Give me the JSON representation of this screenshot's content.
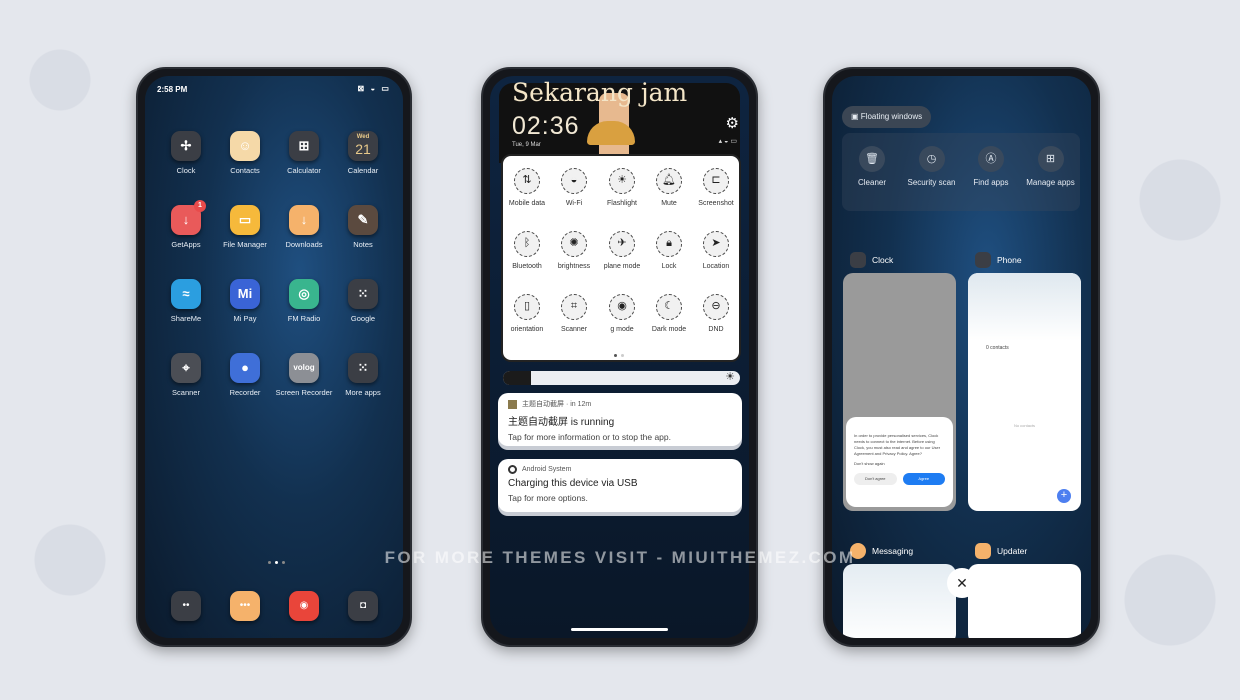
{
  "home": {
    "time": "2:58 PM",
    "apps": [
      {
        "label": "Clock",
        "icon": "clock-icon",
        "color": "#3b3e45",
        "glyph": "✢"
      },
      {
        "label": "Contacts",
        "icon": "contacts-icon",
        "color": "#f5d9a8",
        "glyph": "☺"
      },
      {
        "label": "Calculator",
        "icon": "calculator-icon",
        "color": "#3b3e45",
        "glyph": "⊞"
      },
      {
        "label": "Calendar",
        "icon": "calendar-icon",
        "color": "#3b3e45",
        "glyph": "21",
        "sub": "Wed"
      },
      {
        "label": "GetApps",
        "icon": "getapps-icon",
        "color": "#e95a5a",
        "glyph": "↓",
        "badge": "1"
      },
      {
        "label": "File Manager",
        "icon": "file-manager-icon",
        "color": "#f6b93b",
        "glyph": "▭"
      },
      {
        "label": "Downloads",
        "icon": "downloads-icon",
        "color": "#f5b26b",
        "glyph": "↓"
      },
      {
        "label": "Notes",
        "icon": "notes-icon",
        "color": "#5b4a3f",
        "glyph": "✎"
      },
      {
        "label": "ShareMe",
        "icon": "shareme-icon",
        "color": "#2b9ee0",
        "glyph": "≈"
      },
      {
        "label": "Mi Pay",
        "icon": "mi-pay-icon",
        "color": "#3a64d6",
        "glyph": "Mi"
      },
      {
        "label": "FM Radio",
        "icon": "fm-radio-icon",
        "color": "#39b58e",
        "glyph": "◎"
      },
      {
        "label": "Google",
        "icon": "google-folder-icon",
        "color": "#3b3e45",
        "glyph": "⁙"
      },
      {
        "label": "Scanner",
        "icon": "scanner-icon",
        "color": "#4b4e55",
        "glyph": "⌖"
      },
      {
        "label": "Recorder",
        "icon": "recorder-icon",
        "color": "#3f6fd8",
        "glyph": "●"
      },
      {
        "label": "Screen Recorder",
        "icon": "screen-recorder-icon",
        "color": "#8c8f95",
        "glyph": "volog"
      },
      {
        "label": "More apps",
        "icon": "more-apps-folder-icon",
        "color": "#3b3e45",
        "glyph": "⁙"
      }
    ],
    "dock": [
      {
        "icon": "phone-icon",
        "color": "#3b3e45",
        "glyph": "••"
      },
      {
        "icon": "messaging-icon",
        "color": "#f5b26b",
        "glyph": "•••"
      },
      {
        "icon": "chrome-icon",
        "color": "#e9453a",
        "glyph": "◉"
      },
      {
        "icon": "camera-icon",
        "color": "#3b3e45",
        "glyph": "◘"
      }
    ]
  },
  "control": {
    "greeting": "Sekarang jam",
    "time": "02:36",
    "date": "Tue, 9 Mar",
    "tiles": [
      {
        "label": "Mobile data",
        "glyph": "⇅",
        "icon": "mobile-data-icon"
      },
      {
        "label": "Wi-Fi",
        "glyph": "◒",
        "icon": "wifi-icon"
      },
      {
        "label": "Flashlight",
        "glyph": "☀",
        "icon": "flashlight-icon"
      },
      {
        "label": "Mute",
        "glyph": "🔔︎",
        "icon": "bell-icon"
      },
      {
        "label": "Screenshot",
        "glyph": "⊏",
        "icon": "screenshot-icon"
      },
      {
        "label": "Bluetooth",
        "glyph": "ᛒ",
        "icon": "bluetooth-icon"
      },
      {
        "label": "brightness",
        "glyph": "✺",
        "icon": "brightness-icon"
      },
      {
        "label": "plane mode",
        "glyph": "✈",
        "icon": "airplane-icon"
      },
      {
        "label": "Lock",
        "glyph": "🔒︎",
        "icon": "lock-icon"
      },
      {
        "label": "Location",
        "glyph": "➤",
        "icon": "location-icon"
      },
      {
        "label": "orientation",
        "glyph": "▯",
        "icon": "orientation-icon"
      },
      {
        "label": "Scanner",
        "glyph": "⌗",
        "icon": "scanner-icon"
      },
      {
        "label": "g mode",
        "glyph": "◉",
        "icon": "eye-icon"
      },
      {
        "label": "Dark mode",
        "glyph": "☾",
        "icon": "moon-icon"
      },
      {
        "label": "DND",
        "glyph": "⊖",
        "icon": "dnd-icon"
      }
    ],
    "brightness": 0.12,
    "notifications": [
      {
        "app": "主题自动截屏 · in 12m",
        "title": "主题自动截屏 is running",
        "body": "Tap for more information or to stop the app."
      },
      {
        "app": "Android System",
        "title": "Charging this device via USB",
        "body": "Tap for more options."
      }
    ]
  },
  "recents": {
    "floating": "Floating windows",
    "tools": [
      {
        "label": "Cleaner",
        "glyph": "🗑︎",
        "icon": "trash-icon"
      },
      {
        "label": "Security scan",
        "glyph": "◷",
        "icon": "security-scan-icon"
      },
      {
        "label": "Find apps",
        "glyph": "Ⓐ",
        "icon": "find-apps-icon"
      },
      {
        "label": "Manage apps",
        "glyph": "⊞",
        "icon": "manage-apps-icon"
      }
    ],
    "cards": {
      "clock": "Clock",
      "phone": "Phone",
      "messaging": "Messaging",
      "updater": "Updater"
    },
    "dialog": {
      "text": "In order to provide personalised services, Clock needs to connect to the internet. Before using Clock, you must also read and agree to our User Agreement and Privacy Policy. Agree?",
      "checkbox": "Don't show again",
      "decline": "Don't agree",
      "accept": "Agree"
    },
    "contacts": {
      "count": "0 contacts",
      "empty": "No contacts"
    }
  },
  "watermark": "FOR MORE THEMES VISIT - MIUITHEMEZ.COM"
}
